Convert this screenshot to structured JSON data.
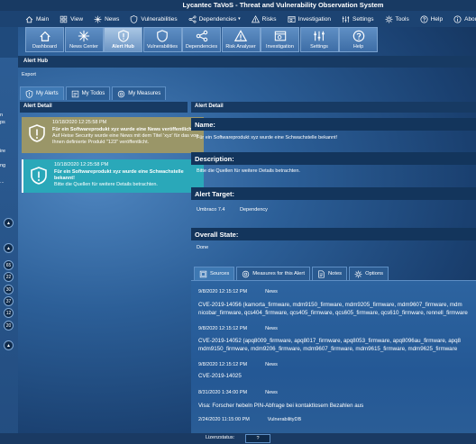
{
  "window": {
    "title": "Lycantec TaVoS - Threat and Vulnerability Observation System"
  },
  "menu": [
    {
      "label": "Main",
      "icon": "home-icon",
      "dropdown": false
    },
    {
      "label": "View",
      "icon": "grid-icon",
      "dropdown": false
    },
    {
      "label": "News",
      "icon": "news-icon",
      "dropdown": false
    },
    {
      "label": "Vulnerabilities",
      "icon": "shield-icon",
      "dropdown": false
    },
    {
      "label": "Dependencies",
      "icon": "dependencies-icon",
      "dropdown": true
    },
    {
      "label": "Risks",
      "icon": "warning-icon",
      "dropdown": false
    },
    {
      "label": "Investigation",
      "icon": "investigation-icon",
      "dropdown": false
    },
    {
      "label": "Settings",
      "icon": "settings-icon",
      "dropdown": false
    },
    {
      "label": "Tools",
      "icon": "gear-icon",
      "dropdown": false
    },
    {
      "label": "Help",
      "icon": "help-icon",
      "dropdown": false
    },
    {
      "label": "About",
      "icon": "info-icon",
      "dropdown": false
    }
  ],
  "ribbon": [
    {
      "label": "Dashboard",
      "icon": "home-icon",
      "active": false
    },
    {
      "label": "News Center",
      "icon": "news-icon",
      "active": false
    },
    {
      "label": "Alert Hub",
      "icon": "alert-icon",
      "active": true
    },
    {
      "label": "Vulnerabilities",
      "icon": "shield-icon",
      "active": false
    },
    {
      "label": "Dependencies",
      "icon": "dependencies-icon",
      "active": false
    },
    {
      "label": "Risk Analyser",
      "icon": "warning-icon",
      "active": false
    },
    {
      "label": "Investigation",
      "icon": "investigation-icon",
      "active": false
    },
    {
      "label": "Settings",
      "icon": "settings-icon",
      "active": false
    },
    {
      "label": "Help",
      "icon": "help-icon",
      "active": false
    }
  ],
  "left_strip": {
    "texts": [
      "n",
      "ps",
      "ire",
      "ng",
      "..."
    ],
    "badges": [
      "65",
      "22",
      "30",
      "37",
      "12",
      "20"
    ]
  },
  "hub": {
    "title": "Alert Hub",
    "export": "Export"
  },
  "tabs": [
    {
      "label": "My Alerts",
      "icon": "alert-icon",
      "active": true
    },
    {
      "label": "My Todos",
      "icon": "todo-icon",
      "active": false
    },
    {
      "label": "My Measures",
      "icon": "measures-icon",
      "active": false
    }
  ],
  "left_panel_title": "Alert Detail",
  "alerts": [
    {
      "date": "10/18/2020 12:25:58 PM",
      "title": "Für ein Softwareprodukt xyz wurde eine News veröffentlicht!",
      "body": "Auf Heise Security wurde eine News mit dem Titel 'xyz' für das von Ihnen definierte Produkt \"123\" veröffentlicht.",
      "color": "#9a9668",
      "icon": "alert-shield-icon"
    },
    {
      "date": "10/18/2020 12:25:58 PM",
      "title": "Für ein Softwareprodukt xyz wurde eine Schwachstelle bekannt!",
      "body": "Bitte die Quellen für weitere Details betrachten.",
      "color": "#2aa8b9",
      "icon": "alert-shield-icon"
    }
  ],
  "detail": {
    "header": "Alert Detail",
    "name_label": "Name:",
    "name_value": "Für ein Softwareprodukt xyz wurde eine Schwachstelle bekannt!",
    "desc_label": "Description:",
    "desc_value": "Bitte die Quellen für weitere Details betrachten.",
    "target_label": "Alert Target:",
    "target_name": "Umbraco 7.4",
    "target_type": "Dependency",
    "state_label": "Overall State:",
    "state_value": "Done"
  },
  "sub_tabs": [
    {
      "label": "Sources",
      "icon": "sources-icon",
      "active": true
    },
    {
      "label": "Measures for this Alert",
      "icon": "measures-icon",
      "active": false
    },
    {
      "label": "Notes",
      "icon": "notes-icon",
      "active": false
    },
    {
      "label": "Options",
      "icon": "gear-icon",
      "active": false
    }
  ],
  "sources": [
    {
      "date": "9/8/2020 12:15:12 PM",
      "type": "News",
      "title": "CVE-2019-14056 (kamorta_firmware, mdm9150_firmware, mdm9205_firmware, mdm9607_firmware, mdm",
      "title2": "nicobar_firmware, qcs404_firmware, qcs405_firmware, qcs605_firmware, qcs610_firmware, rennell_firmware"
    },
    {
      "date": "9/8/2020 12:15:12 PM",
      "type": "News",
      "title": "CVE-2019-14052 (apq8009_firmware, apq8017_firmware, apq8053_firmware, apq8096au_firmware, apq8",
      "title2": "mdm9150_firmware, mdm9206_firmware, mdm9607_firmware, mdm9615_firmware, mdm9625_firmware"
    },
    {
      "date": "9/8/2020 12:15:12 PM",
      "type": "News",
      "title": "CVE-2019-14025",
      "title2": ""
    },
    {
      "date": "8/31/2020 1:34:00 PM",
      "type": "News",
      "title": "Visa: Forscher hebeln PIN-Abfrage bei kontaktlosem Bezahlen aus",
      "title2": ""
    },
    {
      "date": "2/24/2020 11:15:00 PM",
      "type": "VulnerabilityDB",
      "title": "",
      "title2": ""
    }
  ],
  "status": {
    "label": "Lizenzstatus:",
    "value": "?"
  }
}
